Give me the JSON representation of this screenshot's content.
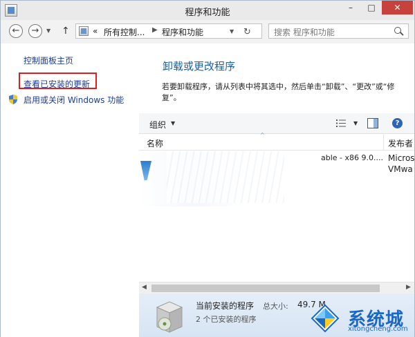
{
  "window": {
    "title": "程序和功能",
    "controls": {
      "minimize": "–",
      "maximize": "□",
      "close": "✕"
    }
  },
  "navbar": {
    "back_icon": "←",
    "forward_icon": "→",
    "dropdown_icon": "▼",
    "up_icon": "↑",
    "breadcrumb": {
      "overflow": "«",
      "parent": "所有控制...",
      "separator": "▶",
      "current": "程序和功能"
    },
    "refresh_icon": "↻",
    "search_placeholder": "搜索 程序和功能"
  },
  "sidebar": {
    "items": [
      {
        "label": "控制面板主页"
      },
      {
        "label": "查看已安装的更新",
        "highlighted": true
      },
      {
        "label": "启用或关闭 Windows 功能",
        "icon": "shield-icon"
      }
    ]
  },
  "main": {
    "title": "卸载或更改程序",
    "description": "若要卸载程序，请从列表中将其选中，然后单击“卸载”、“更改”或“修复”。"
  },
  "toolbar": {
    "organize_label": "组织",
    "dropdown_icon": "▼",
    "help_icon": "?"
  },
  "columns": {
    "name": "名称",
    "sort_icon": "^",
    "publisher": "发布者"
  },
  "programs": [
    {
      "name_fragment": "able - x86 9.0....",
      "publisher": "Micros"
    },
    {
      "name_fragment": "",
      "publisher": "VMwa"
    }
  ],
  "scrollbar": {
    "left_icon": "◀",
    "right_icon": "▶"
  },
  "details": {
    "title": "当前安装的程序",
    "size_label": "总大小:",
    "size_value": "49.7 M",
    "count_text": "2 个已安装的程序"
  },
  "watermark": {
    "name": "系统城",
    "url": "xitongcheng.com"
  },
  "colors": {
    "link": "#1c3b9b",
    "title_blue": "#1a5fa8",
    "highlight_box": "#e21b1b",
    "close_button": "#c7423d",
    "details_bg": "#dce8f5"
  }
}
